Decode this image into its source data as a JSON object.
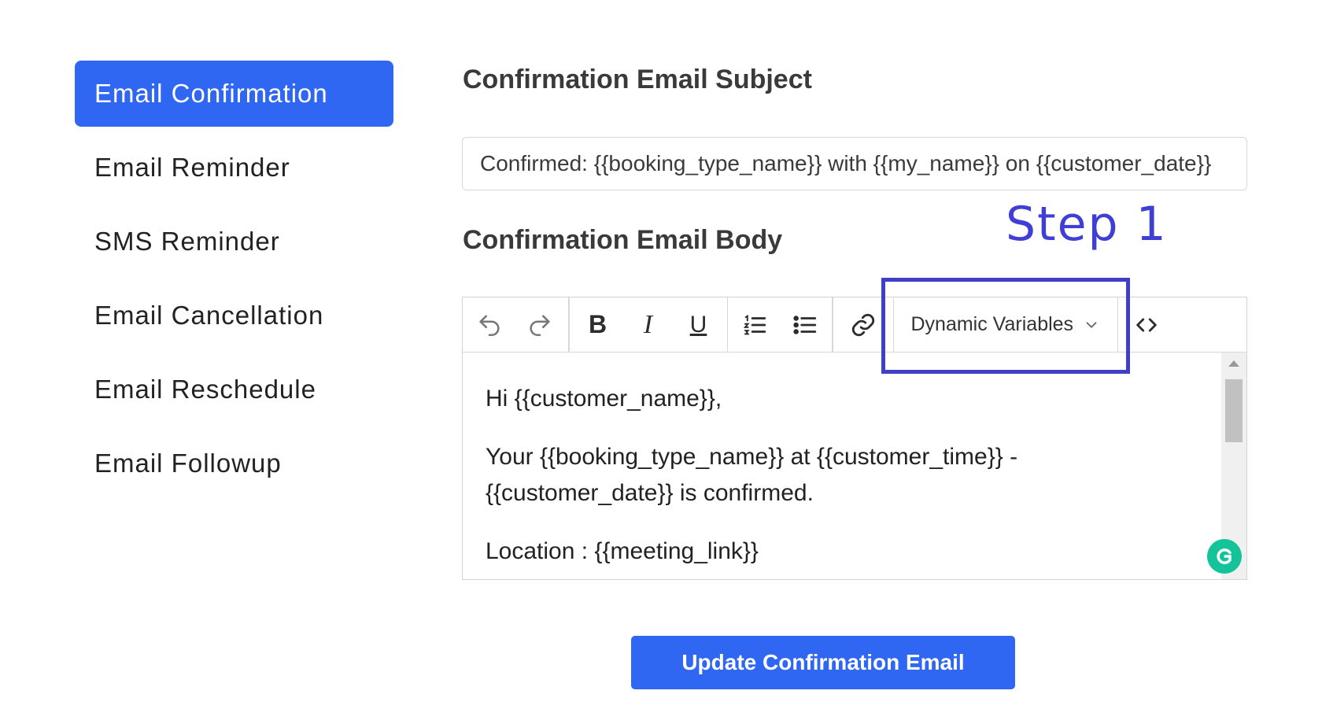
{
  "sidebar": {
    "items": [
      {
        "label": "Email Confirmation",
        "active": true
      },
      {
        "label": "Email Reminder",
        "active": false
      },
      {
        "label": "SMS Reminder",
        "active": false
      },
      {
        "label": "Email Cancellation",
        "active": false
      },
      {
        "label": "Email Reschedule",
        "active": false
      },
      {
        "label": "Email Followup",
        "active": false
      }
    ]
  },
  "subject": {
    "heading": "Confirmation Email Subject",
    "value": "Confirmed: {{booking_type_name}} with {{my_name}} on {{customer_date}}"
  },
  "body": {
    "heading": "Confirmation Email Body",
    "paragraphs": [
      "Hi {{customer_name}},",
      "Your {{booking_type_name}} at {{customer_time}} - {{customer_date}} is confirmed.",
      "Location : {{meeting_link}}"
    ]
  },
  "toolbar": {
    "bold_label": "B",
    "italic_label": "I",
    "underline_label": "U",
    "dynamic_variables_label": "Dynamic Variables",
    "icons": [
      "undo-icon",
      "redo-icon",
      "ordered-list-icon",
      "bullet-list-icon",
      "link-icon",
      "chevron-down-icon",
      "code-icon"
    ]
  },
  "annotation": {
    "step_label": "Step 1",
    "color": "#3f3fc9"
  },
  "actions": {
    "update_label": "Update Confirmation Email"
  },
  "colors": {
    "accent": "#2f66f2",
    "grammarly": "#15c39a"
  }
}
